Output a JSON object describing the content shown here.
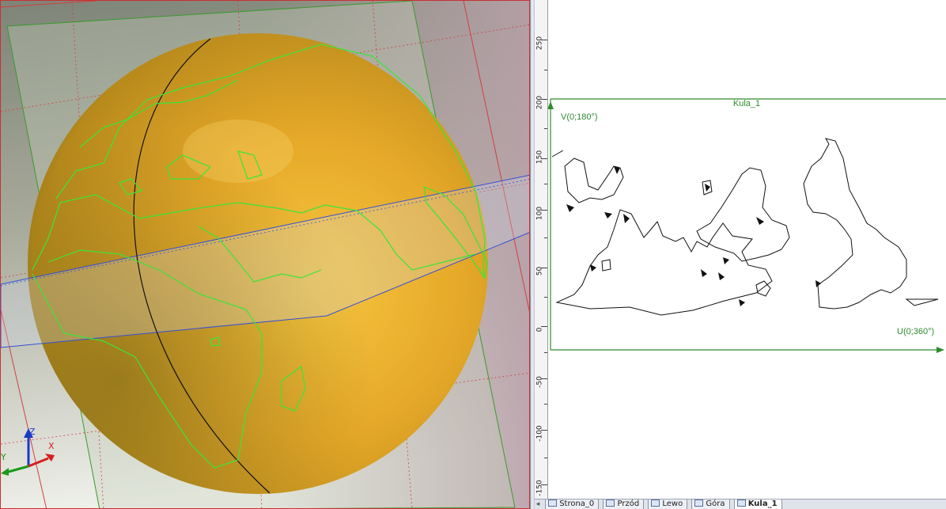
{
  "viewport": {
    "object_name": "Kula_1",
    "axes": {
      "x": "X",
      "y": "Y",
      "z": "Z"
    },
    "colors": {
      "sphere": "#e1a323",
      "continents": "#39e639",
      "planes": "#3b9a2e",
      "equator": "#3450d8",
      "meridian": "#111111"
    }
  },
  "sheet": {
    "frame_title": "Kula_1",
    "v_label": "V(0;180°)",
    "u_label": "U(0;360°)",
    "ruler_labels": [
      "250",
      "200",
      "150",
      "100",
      "50",
      "0",
      "-50",
      "-100",
      "-150"
    ],
    "frame_color": "#2e8b2e"
  },
  "tabs": [
    {
      "label": "Strona_0",
      "active": false
    },
    {
      "label": "Przód",
      "active": false
    },
    {
      "label": "Lewo",
      "active": false
    },
    {
      "label": "Góra",
      "active": false
    },
    {
      "label": "Kula_1",
      "active": true
    }
  ]
}
